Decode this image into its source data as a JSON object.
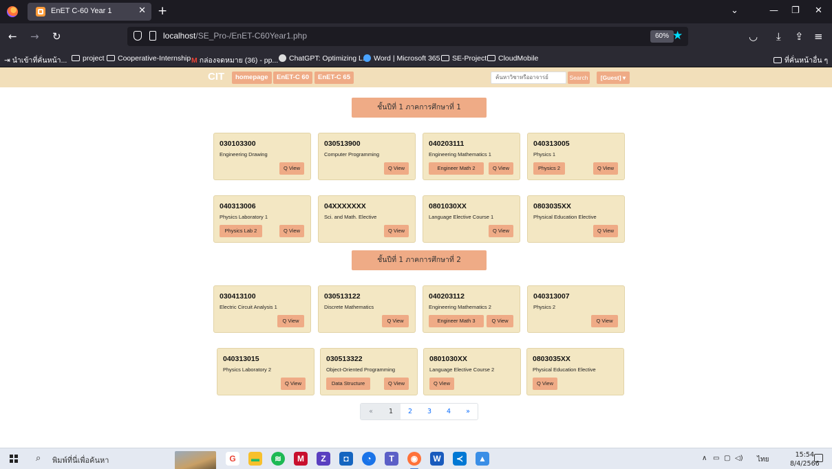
{
  "browser": {
    "tab_title": "EnET C-60 Year 1",
    "url_host": "localhost",
    "url_path": "/SE_Pro-/EnET-C60Year1.php",
    "zoom": "60%",
    "bookmarks": [
      "นำเข้าที่คั่นหน้า...",
      "project",
      "Cooperative-Internship",
      "กล่องจดหมาย (36) - pp...",
      "ChatGPT: Optimizing L...",
      "Word | Microsoft 365",
      "SE-Project",
      "CloudMobile"
    ],
    "other_bookmarks": "ที่คั่นหน้าอื่น ๆ"
  },
  "site": {
    "brand": "CIT",
    "nav": [
      "homepage",
      "EnET-C 60",
      "EnET-C 65"
    ],
    "search_placeholder": "ค้นหาวิชาหรืออาจารย์",
    "search_button": "Search",
    "user_button": "[Guest] ▾"
  },
  "terms": [
    {
      "header": "ชั้นปีที่ 1 ภาคการศึกษาที่ 1",
      "courses": [
        {
          "code": "030103300",
          "name": "Engineering Drawing",
          "buttons": [
            "Q View"
          ]
        },
        {
          "code": "030513900",
          "name": "Computer Programming",
          "buttons": [
            "Q View"
          ]
        },
        {
          "code": "040203111",
          "name": "Engineering Mathematics 1",
          "buttons": [
            "Engineer Math 2",
            "Q View"
          ]
        },
        {
          "code": "040313005",
          "name": "Physics 1",
          "buttons": [
            "Physics 2",
            "Q View"
          ]
        },
        {
          "code": "040313006",
          "name": "Physics Laboratory 1",
          "buttons": [
            "Physics Lab 2",
            "Q View"
          ]
        },
        {
          "code": "04XXXXXXX",
          "name": "Sci. and Math. Elective",
          "buttons": [
            "Q View"
          ]
        },
        {
          "code": "0801030XX",
          "name": "Language Elective Course 1",
          "buttons": [
            "Q View"
          ]
        },
        {
          "code": "0803035XX",
          "name": "Physical Education Elective",
          "buttons": [
            "Q View"
          ]
        }
      ]
    },
    {
      "header": "ชั้นปีที่ 1 ภาคการศึกษาที่ 2",
      "courses": [
        {
          "code": "030413100",
          "name": "Electric Circuit Analysis 1",
          "buttons": [
            "Q View"
          ]
        },
        {
          "code": "030513122",
          "name": "Discrete Mathematics",
          "buttons": [
            "Q View"
          ]
        },
        {
          "code": "040203112",
          "name": "Engineering Mathematics 2",
          "buttons": [
            "Engineer Math 3",
            "Q View"
          ]
        },
        {
          "code": "040313007",
          "name": "Physics 2",
          "buttons": [
            "Q View"
          ]
        },
        {
          "code": "040313015",
          "name": "Physics Laboratory 2",
          "buttons": [
            "Q View"
          ]
        },
        {
          "code": "030513322",
          "name": "Object-Oriented Programming",
          "buttons": [
            "Data Structure",
            "Q View"
          ]
        },
        {
          "code": "0801030XX",
          "name": "Language Elective Course 2",
          "buttons": [
            "Q View"
          ]
        },
        {
          "code": "0803035XX",
          "name": "Physical Education Elective",
          "buttons": [
            "Q View"
          ]
        }
      ]
    }
  ],
  "pagination": [
    "«",
    "1",
    "2",
    "3",
    "4",
    "»"
  ],
  "taskbar": {
    "search_text": "พิมพ์ที่นี่เพื่อค้นหา",
    "language": "ไทย",
    "time": "15:54",
    "date": "8/4/2566"
  },
  "colors": {
    "nav_bg": "#f2dfba",
    "accent": "#efab86",
    "card_bg": "#f3e7c3"
  }
}
